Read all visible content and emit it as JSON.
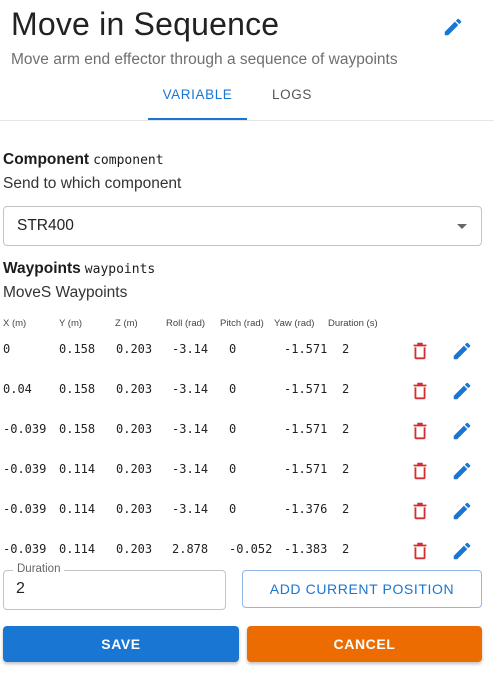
{
  "header": {
    "title": "Move in Sequence",
    "subtitle": "Move arm end effector through a sequence of waypoints"
  },
  "tabs": [
    {
      "label": "VARIABLE",
      "active": true
    },
    {
      "label": "LOGS",
      "active": false
    }
  ],
  "component_field": {
    "label": "Component",
    "code": "component",
    "description": "Send to which component",
    "selected": "STR400"
  },
  "waypoints_field": {
    "label": "Waypoints",
    "code": "waypoints",
    "description": "MoveS Waypoints"
  },
  "table": {
    "columns": [
      "X (m)",
      "Y (m)",
      "Z (m)",
      "Roll (rad)",
      "Pitch (rad)",
      "Yaw (rad)",
      "Duration (s)"
    ],
    "rows": [
      [
        "0",
        "0.158",
        "0.203",
        "-3.14",
        "0",
        "-1.571",
        "2"
      ],
      [
        "0.04",
        "0.158",
        "0.203",
        "-3.14",
        "0",
        "-1.571",
        "2"
      ],
      [
        "-0.039",
        "0.158",
        "0.203",
        "-3.14",
        "0",
        "-1.571",
        "2"
      ],
      [
        "-0.039",
        "0.114",
        "0.203",
        "-3.14",
        "0",
        "-1.571",
        "2"
      ],
      [
        "-0.039",
        "0.114",
        "0.203",
        "-3.14",
        "0",
        "-1.376",
        "2"
      ],
      [
        "-0.039",
        "0.114",
        "0.203",
        "2.878",
        "-0.052",
        "-1.383",
        "2"
      ]
    ]
  },
  "duration_input": {
    "label": "Duration",
    "value": "2"
  },
  "buttons": {
    "add_current_position": "ADD CURRENT POSITION",
    "save": "SAVE",
    "cancel": "CANCEL"
  },
  "icons": {
    "edit": "pencil-icon",
    "delete": "trash-icon",
    "dropdown": "chevron-down-icon"
  },
  "colors": {
    "primary": "#1976d2",
    "cancel": "#ed6c02",
    "delete": "#d32f2f"
  }
}
